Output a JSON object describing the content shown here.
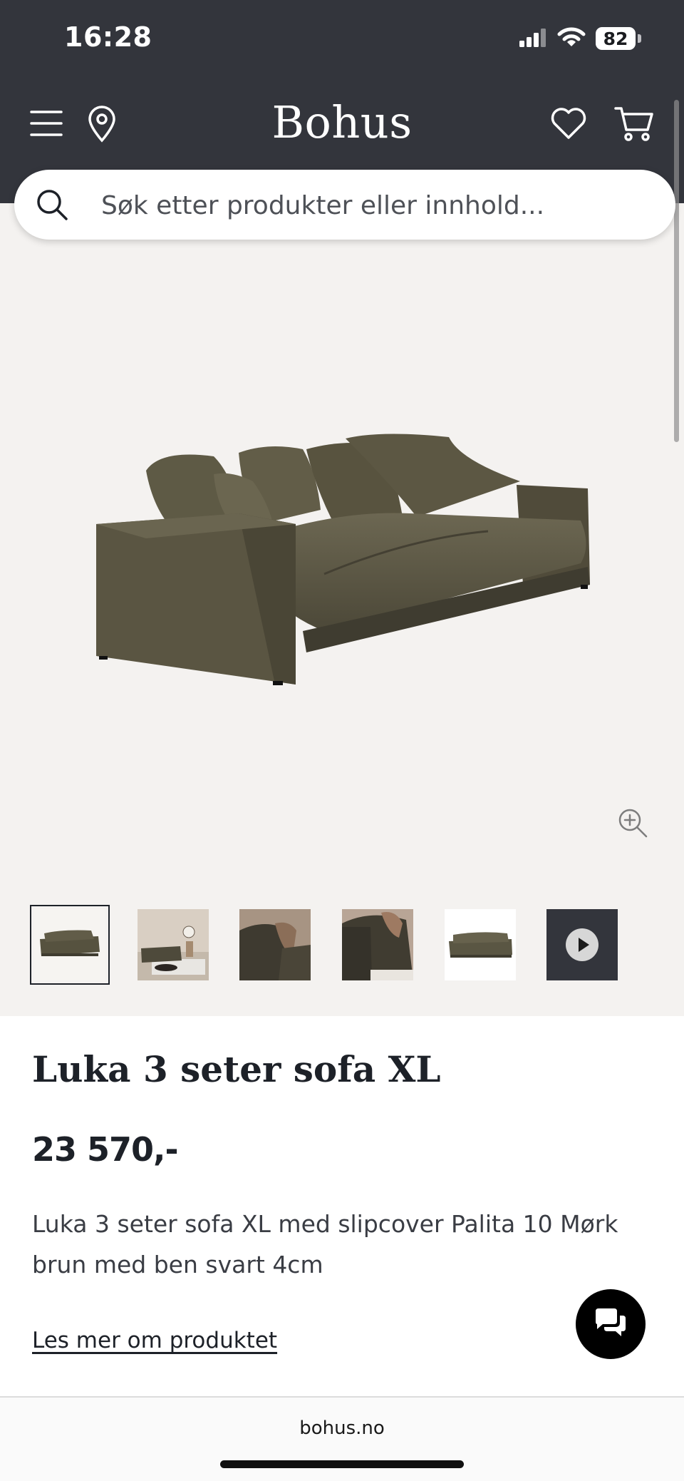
{
  "status_bar": {
    "time": "16:28",
    "battery_level": "82",
    "signal_icon": "cellular-signal-icon",
    "wifi_icon": "wifi-icon"
  },
  "header": {
    "brand": "Bohus",
    "menu_icon": "hamburger-menu-icon",
    "location_icon": "map-pin-icon",
    "wishlist_icon": "heart-icon",
    "cart_icon": "shopping-cart-icon",
    "background_color": "#33353c"
  },
  "search": {
    "placeholder": "Søk etter produkter eller innhold...",
    "value": "",
    "icon": "search-icon"
  },
  "gallery": {
    "main_image": "sofa-product-image",
    "zoom_icon": "zoom-in-icon",
    "background_color": "#f4f2f0",
    "thumbnails": [
      {
        "name": "thumbnail-sofa-front",
        "selected": true
      },
      {
        "name": "thumbnail-living-room",
        "selected": false
      },
      {
        "name": "thumbnail-cushions-closeup",
        "selected": false
      },
      {
        "name": "thumbnail-armrest-closeup",
        "selected": false
      },
      {
        "name": "thumbnail-sofa-side",
        "selected": false
      },
      {
        "name": "thumbnail-video",
        "selected": false,
        "icon": "play-icon"
      }
    ]
  },
  "product": {
    "title": "Luka 3 seter sofa XL",
    "price": "23 570,-",
    "description": "Luka 3 seter sofa XL med slipcover Palita 10 Mørk brun med ben svart 4cm",
    "read_more_link": "Les mer om produktet"
  },
  "chat": {
    "icon": "chat-bubbles-icon"
  },
  "browser": {
    "url": "bohus.no"
  }
}
